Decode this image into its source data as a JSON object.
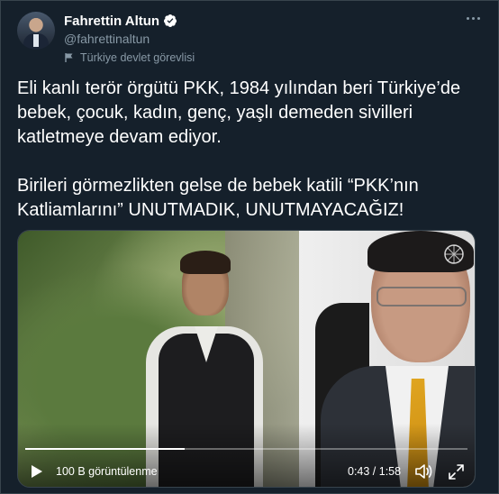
{
  "tweet": {
    "author_name": "Fahrettin Altun",
    "handle": "@fahrettinaltun",
    "account_label": "Türkiye devlet görevlisi",
    "text_paragraph_1": "Eli kanlı terör örgütü PKK, 1984 yılından beri Türkiye’de bebek, çocuk, kadın, genç, yaşlı demeden sivilleri katletmeye devam ediyor.",
    "text_paragraph_2": "Birileri görmezlikten gelse de bebek katili “PKK’nın Katliamlarını” UNUTMADIK, UNUTMAYACAĞIZ!"
  },
  "video": {
    "views": "100 B görüntülenme",
    "time": "0:43 / 1:58",
    "progress_fraction": 0.36
  },
  "icons": {
    "verified": "verified-badge-icon",
    "label": "flag-icon",
    "more": "more-options-icon",
    "play": "play-icon",
    "volume": "volume-icon",
    "fullscreen": "fullscreen-icon"
  },
  "colors": {
    "background": "#15202b",
    "secondary_text": "#8899a6",
    "border": "#38444d"
  }
}
